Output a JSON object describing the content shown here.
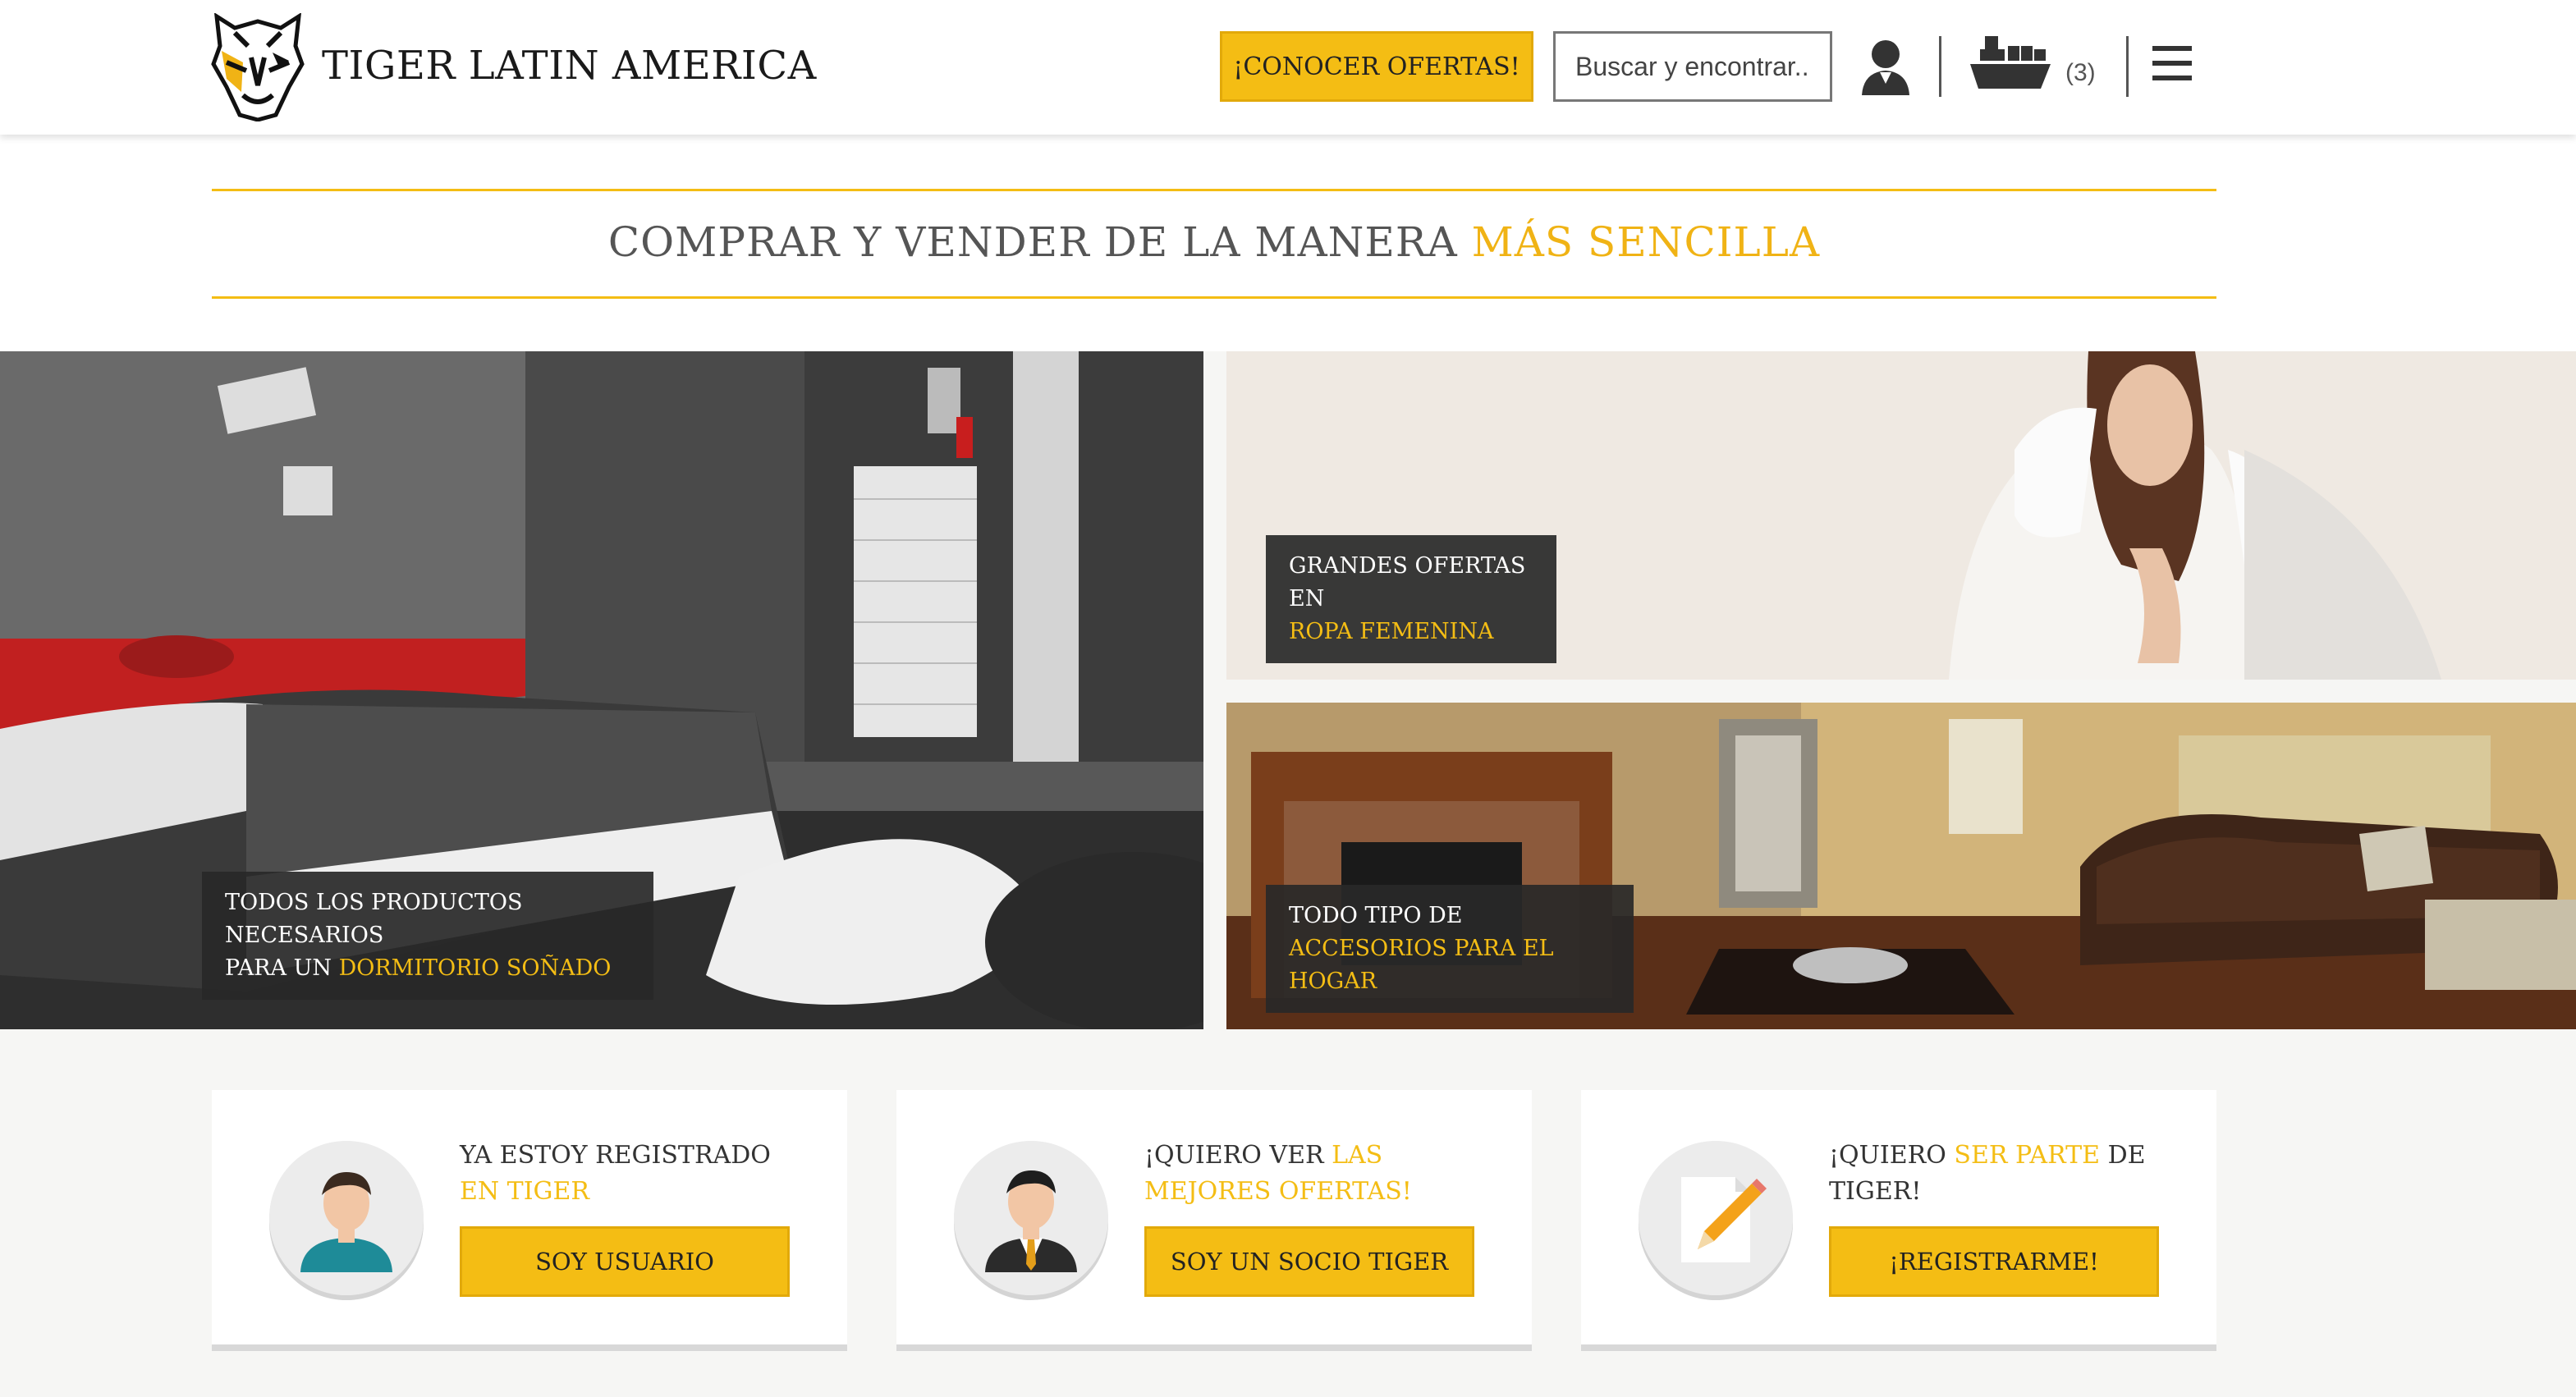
{
  "header": {
    "brand": "TIGER LATIN AMERICA",
    "offers_button": "¡CONOCER OFERTAS!",
    "search_placeholder": "Buscar y encontrar...",
    "cart_count": "(3)"
  },
  "tagline": {
    "text": "COMPRAR Y VENDER DE LA MANERA",
    "highlight": "MÁS SENCILLA"
  },
  "banners": [
    {
      "line1": "TODOS LOS PRODUCTOS NECESARIOS",
      "line2_prefix": "PARA UN ",
      "line2_highlight": "DORMITORIO SOÑADO"
    },
    {
      "line1": "GRANDES OFERTAS EN",
      "line2_prefix": "",
      "line2_highlight": "ROPA FEMENINA"
    },
    {
      "line1": "TODO TIPO DE",
      "line2_prefix": "",
      "line2_highlight": "ACCESORIOS PARA EL HOGAR"
    }
  ],
  "cards": [
    {
      "line1": "YA ESTOY REGISTRADO",
      "line2_highlight": "EN TIGER",
      "button": "SOY USUARIO"
    },
    {
      "line1_prefix": "¡QUIERO VER ",
      "line1_highlight": "LAS",
      "line2_highlight": "MEJORES OFERTAS!",
      "button": "SOY UN SOCIO TIGER"
    },
    {
      "line1_prefix": "¡QUIERO ",
      "line1_highlight": "SER PARTE",
      "line1_suffix": " DE",
      "line2": "TIGER!",
      "button": "¡REGISTRARME!"
    }
  ],
  "colors": {
    "accent": "#f4bd14",
    "dark_label": "#282828"
  },
  "icons": [
    "tiger-logo-icon",
    "user-icon",
    "cargo-ship-icon",
    "hamburger-menu-icon",
    "person-avatar-icon",
    "businessman-avatar-icon",
    "document-pencil-icon"
  ]
}
